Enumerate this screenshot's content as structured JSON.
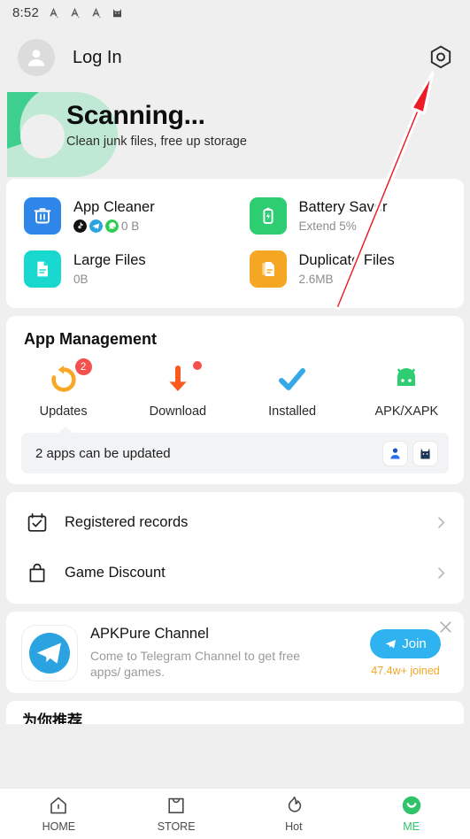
{
  "status_bar": {
    "time": "8:52",
    "icons": [
      "notification-a-icon",
      "notification-a-icon",
      "notification-a-icon",
      "cat-app-icon"
    ]
  },
  "header": {
    "login_label": "Log In",
    "avatar_icon": "person-avatar-icon",
    "settings_icon": "gear-icon"
  },
  "banner": {
    "title": "Scanning...",
    "subtitle": "Clean junk files, free up storage",
    "color_primary": "#3ecf8e",
    "color_ring": "#bfe9d4"
  },
  "features": [
    {
      "title": "App Cleaner",
      "sub": "0 B",
      "icon": "trash-icon",
      "color": "#2f86e8",
      "mini_icons": [
        "tiktok-icon",
        "telegram-icon",
        "whatsapp-icon"
      ]
    },
    {
      "title": "Battery Saver",
      "sub": "Extend 5%",
      "icon": "battery-bolt-icon",
      "color": "#2ecd72",
      "mini_icons": []
    },
    {
      "title": "Large Files",
      "sub": "0B",
      "icon": "document-icon",
      "color": "#18d8d0",
      "mini_icons": []
    },
    {
      "title": "Duplicate Files",
      "sub": "2.6MB",
      "icon": "duplicate-docs-icon",
      "color": "#f5a623",
      "mini_icons": []
    }
  ],
  "app_management": {
    "title": "App Management",
    "items": [
      {
        "label": "Updates",
        "icon": "refresh-icon",
        "badge": "2",
        "dot": false,
        "color": "#f9a825"
      },
      {
        "label": "Download",
        "icon": "download-icon",
        "badge": null,
        "dot": true,
        "color": "#fb5a1e"
      },
      {
        "label": "Installed",
        "icon": "check-icon",
        "badge": null,
        "dot": false,
        "color": "#34a8e8"
      },
      {
        "label": "APK/XAPK",
        "icon": "android-icon",
        "badge": null,
        "dot": false,
        "color": "#2ecd72"
      }
    ],
    "note": "2 apps can be updated",
    "note_app_icons": [
      "blue-person-app-icon",
      "dark-cat-app-icon"
    ]
  },
  "rows": [
    {
      "label": "Registered records",
      "icon": "calendar-check-icon",
      "chevron": "chevron-right-icon"
    },
    {
      "label": "Game Discount",
      "icon": "shopping-bag-icon",
      "chevron": "chevron-right-icon"
    }
  ],
  "promo": {
    "title": "APKPure Channel",
    "description": "Come to Telegram Channel to get free apps/ games.",
    "join_label": "Join",
    "joined_count": "47.4w+ joined",
    "app_icon": "telegram-icon",
    "send_icon": "paper-plane-icon",
    "close_icon": "close-icon",
    "join_color": "#2eb3f0",
    "joined_color": "#f5a623"
  },
  "partial_section": {
    "title": "为你推荐"
  },
  "bottom_nav": {
    "active": "ME",
    "active_color": "#2fc36a",
    "items": [
      {
        "label": "HOME",
        "icon": "home-icon"
      },
      {
        "label": "STORE",
        "icon": "store-bag-icon"
      },
      {
        "label": "Hot",
        "icon": "flame-icon"
      },
      {
        "label": "ME",
        "icon": "smiley-face-icon"
      }
    ]
  },
  "annotation": {
    "arrow": "red-arrow-pointing-to-settings",
    "color": "#ec1c24"
  }
}
